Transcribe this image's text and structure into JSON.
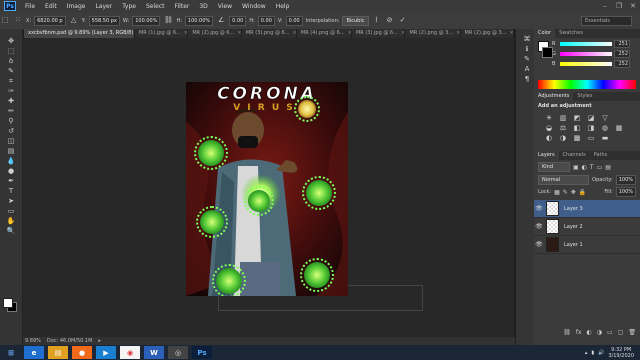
{
  "menubar": {
    "logo": "Ps",
    "items": [
      "File",
      "Edit",
      "Image",
      "Layer",
      "Type",
      "Select",
      "Filter",
      "3D",
      "View",
      "Window",
      "Help"
    ],
    "window_controls": [
      "–",
      "❐",
      "✕"
    ]
  },
  "options": {
    "x_label": "X:",
    "x_value": "6820.00 p",
    "y_label": "Y:",
    "y_value": "558.50 px",
    "w_label": "W:",
    "w_value": "100.00%",
    "h_label": "H:",
    "h_value": "100.00%",
    "angle_value": "0.00",
    "hskew_label": "H:",
    "hskew_value": "0.00",
    "vskew_label": "V:",
    "vskew_value": "0.00",
    "interp_label": "Interpolation:",
    "interp_value": "Bicubic",
    "workspace": "Essentials"
  },
  "tabs": [
    {
      "label": "xxcbvfbnm.psd @ 9.89% (Layer 3, RGB/8)",
      "active": true
    },
    {
      "label": "MR (1).jpg @ 6...",
      "active": false
    },
    {
      "label": "MR (2).jpg @ 6...",
      "active": false
    },
    {
      "label": "MR (3).png @ 6...",
      "active": false
    },
    {
      "label": "MR (4).png @ 6...",
      "active": false
    },
    {
      "label": "MR (3).jpg @ 6...",
      "active": false
    },
    {
      "label": "MR (2).png @ 3...",
      "active": false
    },
    {
      "label": "MR (2).jpg @ 3...",
      "active": false
    }
  ],
  "tools": [
    "move-icon",
    "marquee-icon",
    "lasso-icon",
    "quick-select-icon",
    "crop-icon",
    "eyedropper-icon",
    "healing-icon",
    "brush-icon",
    "clone-stamp-icon",
    "history-brush-icon",
    "eraser-icon",
    "gradient-icon",
    "blur-icon",
    "dodge-icon",
    "pen-icon",
    "type-icon",
    "path-select-icon",
    "shape-icon",
    "hand-icon",
    "zoom-icon"
  ],
  "tool_glyphs": [
    "✥",
    "⬚",
    "ꝺ",
    "✎",
    "⌗",
    "✑",
    "✚",
    "✏",
    "⚲",
    "↺",
    "◫",
    "▤",
    "💧",
    "●",
    "✒",
    "T",
    "➤",
    "▭",
    "✋",
    "🔍"
  ],
  "poster": {
    "title": "CORONA",
    "subtitle": "V I R U S"
  },
  "status": {
    "zoom": "9.89%",
    "doc": "Doc: 46.0M/50.1M"
  },
  "color_panel": {
    "tabs": [
      "Color",
      "Swatches"
    ],
    "channels": [
      {
        "label": "R",
        "value": "251"
      },
      {
        "label": "G",
        "value": "252"
      },
      {
        "label": "B",
        "value": "252"
      }
    ]
  },
  "adjustments": {
    "tabs": [
      "Adjustments",
      "Styles"
    ],
    "heading": "Add an adjustment",
    "icons": [
      "☀",
      "▥",
      "◩",
      "◪",
      "▽",
      "",
      "◒",
      "⚖",
      "◧",
      "◨",
      "◍",
      "▦",
      "◐",
      "◑",
      "▩",
      "▭",
      "▬",
      ""
    ]
  },
  "layers_panel": {
    "tabs": [
      "Layers",
      "Channels",
      "Paths"
    ],
    "kind": "Kind",
    "blend_mode": "Normal",
    "opacity_label": "Opacity:",
    "opacity_value": "100%",
    "lock_label": "Lock:",
    "fill_label": "Fill:",
    "fill_value": "100%",
    "layers": [
      {
        "name": "Layer 3",
        "active": true
      },
      {
        "name": "Layer 2",
        "active": false
      },
      {
        "name": "Layer 1",
        "active": false
      }
    ],
    "footer_icons": [
      "⛓",
      "fx",
      "◐",
      "◑",
      "▭",
      "▢",
      "🗑"
    ]
  },
  "taskbar": {
    "apps": [
      "start-button",
      "ie-icon",
      "explorer-icon",
      "firefox-icon",
      "media-icon",
      "chrome-icon",
      "word-icon",
      "camera-icon",
      "photoshop-icon"
    ],
    "app_glyphs": [
      "⊞",
      "e",
      "▤",
      "●",
      "▶",
      "◉",
      "W",
      "◎",
      "Ps"
    ],
    "time": "9:32 PM",
    "date": "3/19/2020"
  }
}
